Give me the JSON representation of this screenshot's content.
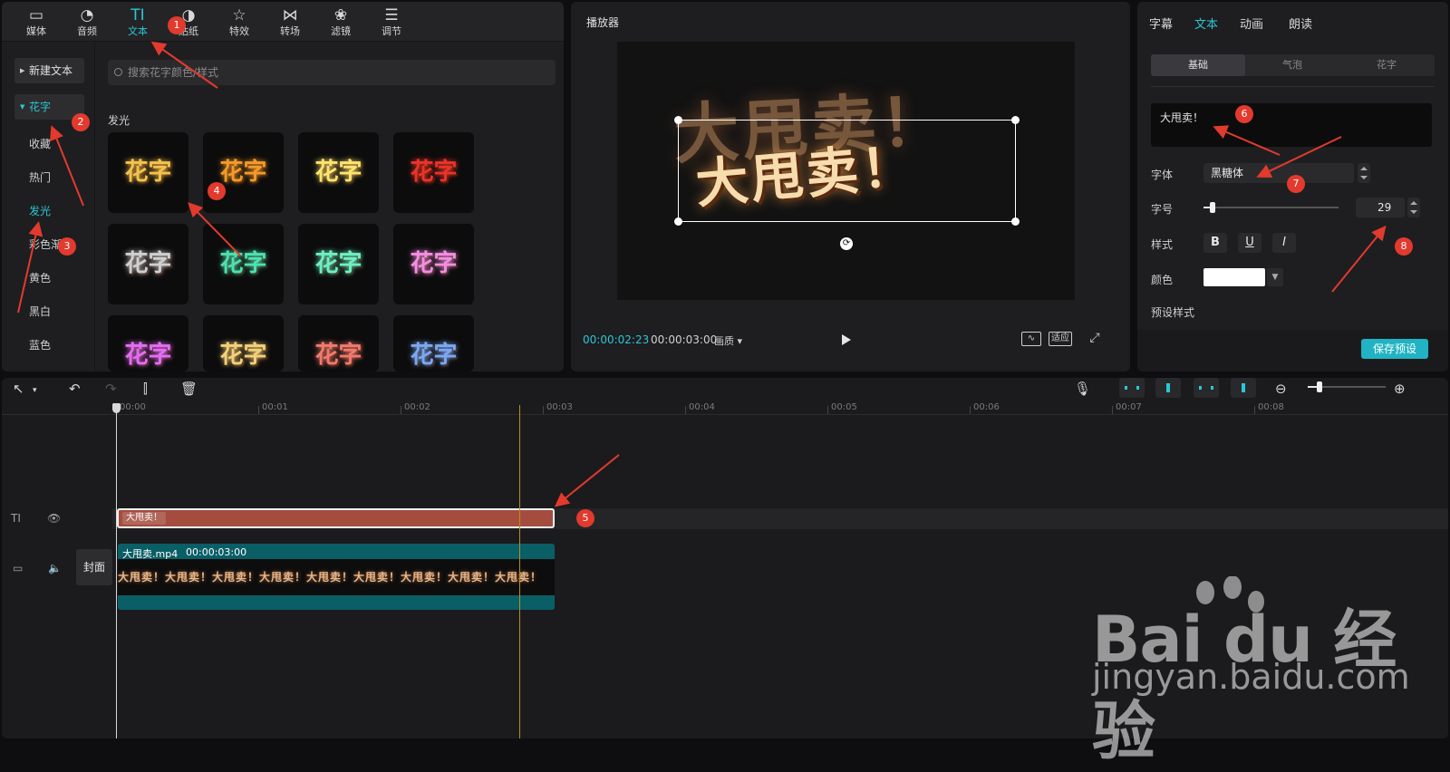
{
  "toolbar": {
    "tools": [
      {
        "label": "媒体",
        "icon": "media-icon"
      },
      {
        "label": "音频",
        "icon": "audio-icon"
      },
      {
        "label": "文本",
        "icon": "text-icon",
        "glyph": "TI"
      },
      {
        "label": "贴纸",
        "icon": "sticker-icon"
      },
      {
        "label": "特效",
        "icon": "effects-icon"
      },
      {
        "label": "转场",
        "icon": "transition-icon"
      },
      {
        "label": "滤镜",
        "icon": "filter-icon"
      },
      {
        "label": "调节",
        "icon": "adjust-icon"
      }
    ]
  },
  "sidebar": {
    "new_text": "新建文本",
    "category": "花字",
    "items": [
      "收藏",
      "热门",
      "发光",
      "彩色渐",
      "黄色",
      "黑白",
      "蓝色"
    ]
  },
  "library": {
    "search_placeholder": "搜索花字颜色/样式",
    "section": "发光",
    "preset_text": "花字",
    "preset_colors": [
      "#f3c24e",
      "#f29a2a",
      "#fde36f",
      "#e8342a",
      "#cfcfcf",
      "#4fe0b0",
      "#6ef0c2",
      "#f28ee0",
      "#e36ef2",
      "#f2d07a",
      "#f07a6e",
      "#7aa8f2"
    ]
  },
  "player": {
    "title": "播放器",
    "overlay_text": "大甩卖！",
    "current_time": "00:00:02:23",
    "total_time": "00:00:03:00",
    "quality": "画质",
    "waveform_btn": "波形",
    "fit_btn": "适应"
  },
  "properties": {
    "tabs": [
      "字幕",
      "文本",
      "动画",
      "朗读"
    ],
    "subtabs": [
      "基础",
      "气泡",
      "花字"
    ],
    "text_value": "大甩卖！",
    "font_label": "字体",
    "font_value": "黑糖体",
    "size_label": "字号",
    "size_value": "29",
    "size_fraction": 0.07,
    "style_label": "样式",
    "style_bold": "B",
    "style_underline": "U",
    "style_italic": "I",
    "color_label": "颜色",
    "color_value": "#ffffff",
    "preset_label": "预设样式",
    "save_preset": "保存预设"
  },
  "timeline": {
    "ruler": [
      "00:00",
      "00:01",
      "00:02",
      "00:03",
      "00:04",
      "00:05",
      "00:06",
      "00:07",
      "00:08"
    ],
    "text_clip": "大甩卖！",
    "video_name": "大甩卖.mp4",
    "video_duration": "00:00:03:00",
    "video_frames": "大甩卖！大甩卖！大甩卖！大甩卖！大甩卖！大甩卖！大甩卖！大甩卖！大甩卖！",
    "cover": "封面",
    "text_track_label": "TI",
    "zoom_fraction": 0.15
  },
  "annotations": [
    "1",
    "2",
    "3",
    "4",
    "5",
    "6",
    "7",
    "8"
  ],
  "watermark": {
    "brand": "Bai du 经验",
    "url": "jingyan.baidu.com"
  }
}
